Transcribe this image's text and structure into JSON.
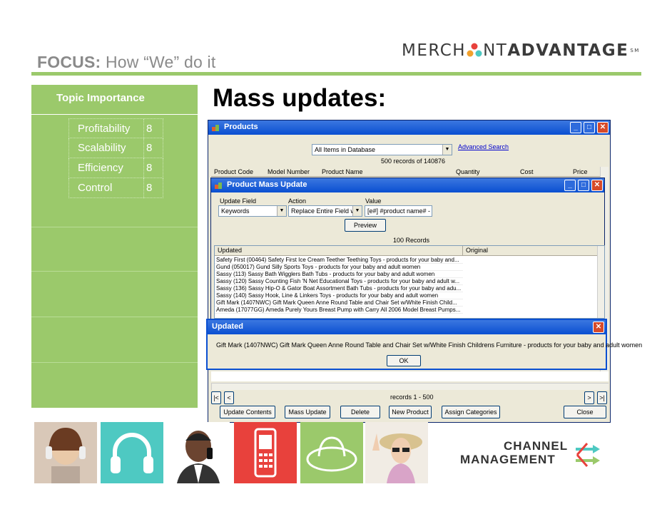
{
  "header": {
    "title_bold": "FOCUS:",
    "title_rest": "How “We” do it"
  },
  "logo": {
    "left": "MERCH",
    "right": "NT",
    "bold": "ADVANTAGE",
    "mark": "SM"
  },
  "panel": {
    "heading": "Topic Importance",
    "rows": [
      {
        "name": "Profitability",
        "value": "8"
      },
      {
        "name": "Scalability",
        "value": "8"
      },
      {
        "name": "Efficiency",
        "value": "8"
      },
      {
        "name": "Control",
        "value": "8"
      }
    ]
  },
  "slide_heading": "Mass updates:",
  "products_window": {
    "title": "Products",
    "filter": "All Items in Database",
    "advanced_search": "Advanced Search",
    "records_count": "500 records of 140876",
    "columns": [
      "Product Code",
      "Model Number",
      "Product Name",
      "Quantity",
      "Cost",
      "Price"
    ],
    "records_range": "records 1 - 500",
    "nav": {
      "first": "|<",
      "prev": "<",
      "next": ">",
      "last": ">|"
    },
    "buttons": [
      "Update Contents",
      "Mass Update",
      "Delete",
      "New Product",
      "Assign Categories",
      "Close"
    ]
  },
  "mass_update_window": {
    "title": "Product Mass Update",
    "update_field_label": "Update Field",
    "action_label": "Action",
    "value_label": "Value",
    "update_field": "Keywords",
    "action": "Replace Entire Field with",
    "value": "[e#] #product name# - pro",
    "preview_button": "Preview",
    "records": "100 Records",
    "col_updated": "Updated",
    "col_original": "Original",
    "rows": [
      "Safety First (00464) Safety First Ice Cream Teether Teething Toys - products for your baby and...",
      "Gund (050017) Gund Silly Sports Toys - products for your baby and adult women",
      "Sassy (113) Sassy Bath Wigglers Bath Tubs - products for your baby and adult women",
      "Sassy (120) Sassy Counting Fish 'N Net Educational Toys - products for your baby and adult w...",
      "Sassy (136) Sassy Hip-O & Gator Boat Assortment Bath Tubs - products for your baby and adu...",
      "Sassy (140) Sassy Hook, Line & Linkers Toys - products for your baby and adult women",
      "Gift Mark (1407NWC) Gift Mark Queen Anne Round Table and Chair Set w/White Finish Child...",
      "Ameda (17077GG) Ameda Purely Yours Breast Pump with Carry All 2006 Model Breast Pumps..."
    ]
  },
  "dialog": {
    "title": "Updated",
    "message": "Gift Mark (1407NWC) Gift Mark Queen Anne Round Table and Chair Set w/White Finish Childrens Furniture - products for your baby and adult women",
    "ok": "OK"
  },
  "bottom_logo": {
    "line1": "CHANNEL",
    "line2": "MANAGEMENT"
  },
  "colors": {
    "accent_green": "#9bc96b",
    "teal": "#4ec9c2",
    "red": "#e8413c",
    "xp_blue": "#0a4fd1"
  }
}
